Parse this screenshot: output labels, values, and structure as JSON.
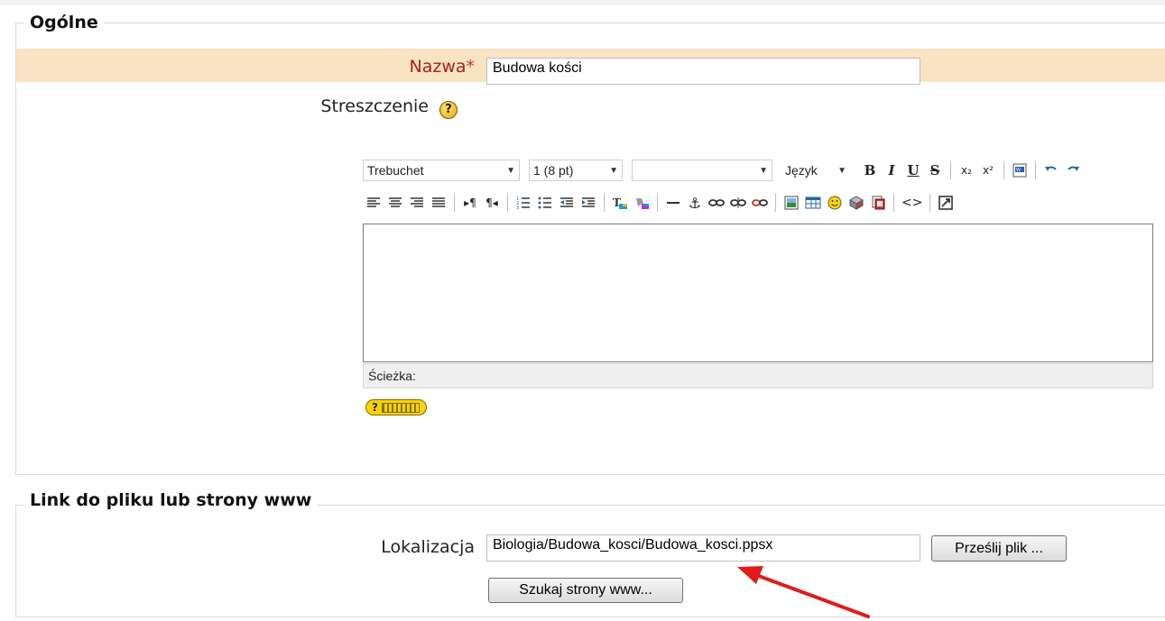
{
  "sections": {
    "general": {
      "legend": "Ogólne",
      "name_label": "Nazwa",
      "required_mark": "*",
      "name_value": "Budowa kości",
      "summary_label": "Streszczenie",
      "help_glyph": "?"
    },
    "link": {
      "legend": "Link do pliku lub strony www",
      "location_label": "Lokalizacja",
      "location_value": "Biologia/Budowa_kosci/Budowa_kosci.ppsx",
      "upload_button": "Prześlij plik ...",
      "search_button": "Szukaj strony www..."
    }
  },
  "editor": {
    "font_family": "Trebuchet",
    "font_size": "1 (8 pt)",
    "style": "",
    "language": "Język",
    "toolbar1": {
      "bold": "B",
      "italic": "I",
      "underline": "U",
      "strike": "S",
      "subscript": "x₂",
      "superscript": "x²"
    },
    "path_label": "Ścieżka:",
    "kbd_help": "?"
  },
  "colors": {
    "required_row_bg": "#fae3c3",
    "required_label": "#a52020",
    "arrow": "#e01b1b"
  },
  "icons": [
    "undo-icon",
    "redo-icon",
    "paste-word-icon",
    "align-left-icon",
    "align-center-icon",
    "align-right-icon",
    "justify-icon",
    "ltr-icon",
    "rtl-icon",
    "ordered-list-icon",
    "unordered-list-icon",
    "outdent-icon",
    "indent-icon",
    "text-color-icon",
    "background-color-icon",
    "horizontal-rule-icon",
    "anchor-icon",
    "link-icon",
    "unlink-icon",
    "nolink-icon",
    "image-icon",
    "table-icon",
    "smiley-icon",
    "special-char-icon",
    "search-replace-icon",
    "html-source-icon",
    "fullscreen-icon",
    "help-icon",
    "keyboard-help-icon",
    "red-arrow-annotation"
  ]
}
